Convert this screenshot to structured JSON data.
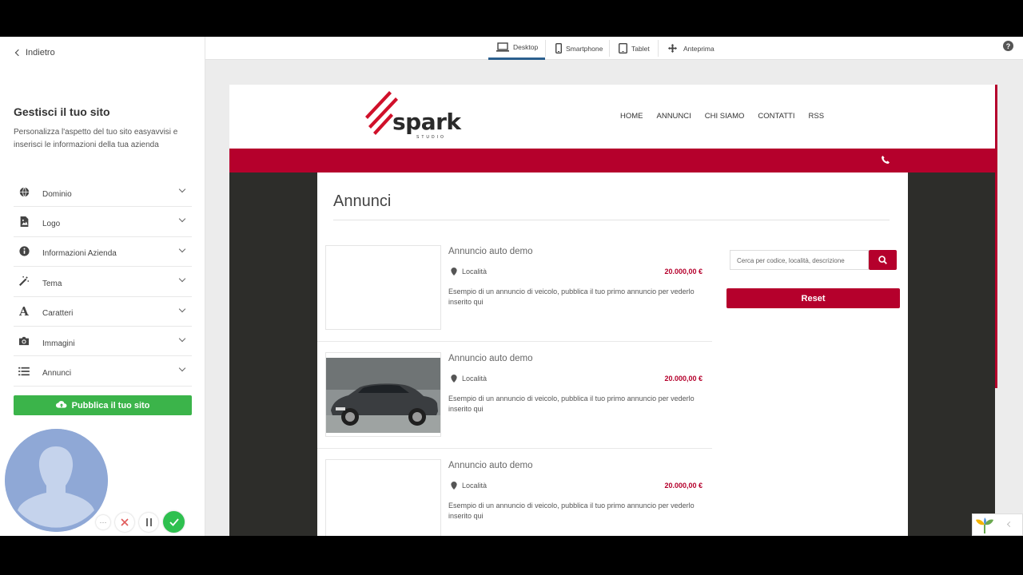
{
  "sidebar": {
    "back_label": "Indietro",
    "title": "Gestisci il tuo sito",
    "description": "Personalizza l'aspetto del tuo sito easyavvisi e inserisci le informazioni della tua azienda",
    "items": [
      {
        "label": "Dominio",
        "icon": "globe-icon"
      },
      {
        "label": "Logo",
        "icon": "image-file-icon"
      },
      {
        "label": "Informazioni Azienda",
        "icon": "info-icon"
      },
      {
        "label": "Tema",
        "icon": "magic-wand-icon"
      },
      {
        "label": "Caratteri",
        "icon": "font-icon"
      },
      {
        "label": "Immagini",
        "icon": "camera-icon"
      },
      {
        "label": "Annunci",
        "icon": "list-icon"
      }
    ],
    "publish_label": "Pubblica il tuo sito"
  },
  "toolbar": {
    "desktop": "Desktop",
    "smartphone": "Smartphone",
    "tablet": "Tablet",
    "preview": "Anteprima"
  },
  "site": {
    "logo_text": "spark",
    "logo_sub": "STUDIO",
    "nav": [
      "HOME",
      "ANNUNCI",
      "CHI SIAMO",
      "CONTATTI",
      "RSS"
    ],
    "page_title": "Annunci",
    "search_placeholder": "Cerca per codice, località, descrizione",
    "reset_label": "Reset",
    "listings": [
      {
        "title": "Annuncio auto demo",
        "location": "Località",
        "price": "20.000,00 €",
        "description": "Esempio di un annuncio di veicolo, pubblica il tuo primo annuncio per vederlo inserito qui",
        "has_image": false
      },
      {
        "title": "Annuncio auto demo",
        "location": "Località",
        "price": "20.000,00 €",
        "description": "Esempio di un annuncio di veicolo, pubblica il tuo primo annuncio per vederlo inserito qui",
        "has_image": true
      },
      {
        "title": "Annuncio auto demo",
        "location": "Località",
        "price": "20.000,00 €",
        "description": "Esempio di un annuncio di veicolo, pubblica il tuo primo annuncio per vederlo inserito qui",
        "has_image": false
      }
    ]
  },
  "colors": {
    "accent_red": "#b5002c",
    "publish_green": "#3bb44a",
    "active_tab": "#2b5f8e"
  }
}
